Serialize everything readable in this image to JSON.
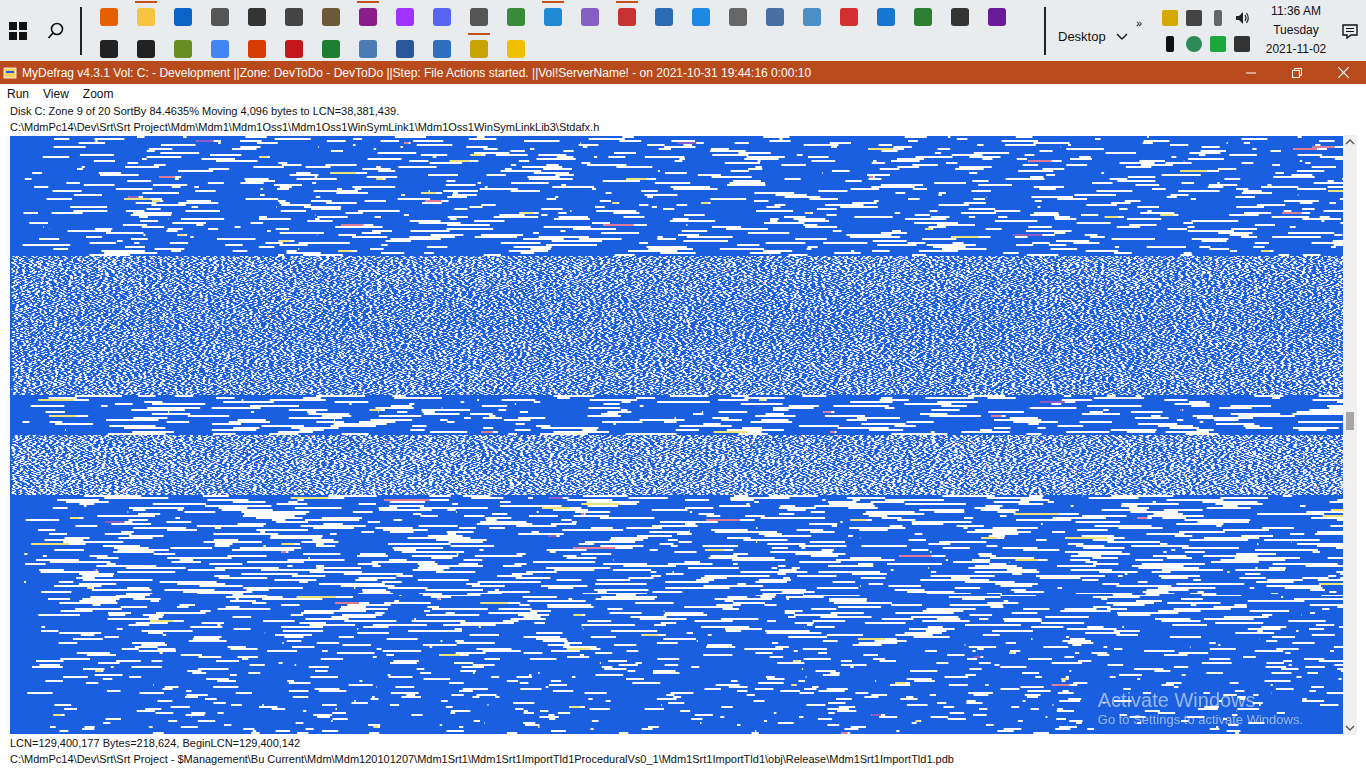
{
  "taskbar": {
    "top_row": [
      {
        "color": "#e66000",
        "running": false
      },
      {
        "color": "#f5c542",
        "running": true
      },
      {
        "color": "#0a64c8",
        "running": false
      },
      {
        "color": "#555555",
        "running": false
      },
      {
        "color": "#333333",
        "running": false
      },
      {
        "color": "#444444",
        "running": false
      },
      {
        "color": "#6b5a3a",
        "running": false
      },
      {
        "color": "#8b1c8b",
        "running": true
      },
      {
        "color": "#a033ff",
        "running": false
      },
      {
        "color": "#5865f2",
        "running": false
      },
      {
        "color": "#555555",
        "running": false
      },
      {
        "color": "#3a8a3a",
        "running": false
      },
      {
        "color": "#1f8ad2",
        "running": true
      },
      {
        "color": "#865fc5",
        "running": false
      },
      {
        "color": "#c83232",
        "running": true
      },
      {
        "color": "#2b6cb0",
        "running": false
      },
      {
        "color": "#1e88e5",
        "running": false
      },
      {
        "color": "#666666",
        "running": false
      },
      {
        "color": "#4a6fa5",
        "running": false
      },
      {
        "color": "#4a8fc5",
        "running": false
      },
      {
        "color": "#d32f2f",
        "running": false
      },
      {
        "color": "#1976d2",
        "running": false
      },
      {
        "color": "#2e7d32",
        "running": false
      },
      {
        "color": "#333333",
        "running": false
      },
      {
        "color": "#6a1b9a",
        "running": false
      }
    ],
    "bottom_row": [
      {
        "color": "#222222",
        "running": false
      },
      {
        "color": "#222222",
        "running": false
      },
      {
        "color": "#6b8e23",
        "running": false
      },
      {
        "color": "#4285f4",
        "running": false
      },
      {
        "color": "#d83b01",
        "running": false
      },
      {
        "color": "#c4161c",
        "running": false
      },
      {
        "color": "#1e7e34",
        "running": false
      },
      {
        "color": "#4a7bb5",
        "running": false
      },
      {
        "color": "#2b579a",
        "running": false
      },
      {
        "color": "#2f6fbf",
        "running": false
      },
      {
        "color": "#c8a400",
        "running": true
      },
      {
        "color": "#f0c000",
        "running": false
      }
    ],
    "toolbar": {
      "overflow": "»",
      "label": "Desktop"
    },
    "clock": {
      "time": "11:36 AM",
      "day": "Tuesday",
      "date": "2021-11-02"
    }
  },
  "window": {
    "title": "MyDefrag v4.3.1   Vol: C: - Development ||Zone: DevToDo - DevToDo ||Step: File Actions started. ||Vol!ServerName! -  on 2021-10-31 19:44:16 0:00:10",
    "menu": [
      "Run",
      "View",
      "Zoom"
    ],
    "status_line": "Disk C:   Zone 9 of 20   SortBy  84.4635%   Moving 4,096 bytes to LCN=38,381,439.",
    "current_file": "C:\\MdmPc14\\Dev\\Srt\\Srt Project\\Mdm\\Mdm1\\Mdm1Oss1\\Mdm1Oss1WinSymLink1\\Mdm1Oss1WinSymLinkLib3\\Stdafx.h",
    "disk_map": {
      "bands": [
        {
          "kind": "streak",
          "level": 0.72
        },
        {
          "kind": "streak",
          "level": 0.7
        },
        {
          "kind": "streak",
          "level": 0.68
        },
        {
          "kind": "streak",
          "level": 0.7
        },
        {
          "kind": "streak",
          "level": 0.66
        },
        {
          "kind": "streak",
          "level": 0.62
        },
        {
          "kind": "speckle",
          "level": 0.6
        },
        {
          "kind": "speckle",
          "level": 0.62
        },
        {
          "kind": "speckle",
          "level": 0.66
        },
        {
          "kind": "speckle",
          "level": 0.68
        },
        {
          "kind": "speckle",
          "level": 0.64
        },
        {
          "kind": "speckle",
          "level": 0.62
        },
        {
          "kind": "speckle",
          "level": 0.6
        },
        {
          "kind": "streak",
          "level": 0.6
        },
        {
          "kind": "streak",
          "level": 0.58
        },
        {
          "kind": "speckle",
          "level": 0.55
        },
        {
          "kind": "speckle",
          "level": 0.52
        },
        {
          "kind": "speckle",
          "level": 0.5
        },
        {
          "kind": "streak",
          "level": 0.5
        },
        {
          "kind": "streak",
          "level": 0.52
        },
        {
          "kind": "streak",
          "level": 0.55
        },
        {
          "kind": "streak",
          "level": 0.52
        },
        {
          "kind": "streak",
          "level": 0.5
        },
        {
          "kind": "streak",
          "level": 0.55
        },
        {
          "kind": "streak",
          "level": 0.6
        },
        {
          "kind": "streak",
          "level": 0.72
        },
        {
          "kind": "streak",
          "level": 0.78
        },
        {
          "kind": "streak",
          "level": 0.8
        },
        {
          "kind": "streak",
          "level": 0.84
        },
        {
          "kind": "streak",
          "level": 0.86
        }
      ]
    },
    "scrollbar": {
      "level": 0.46
    },
    "watermark": {
      "title": "Activate Windows",
      "subtitle": "Go to Settings to activate Windows."
    },
    "footer": {
      "cluster_info": "LCN=129,400,177     Bytes=218,624, BeginLCN=129,400,142",
      "file": "C:\\MdmPc14\\Dev\\Srt\\Srt Project - $Management\\Bu Current\\Mdm\\Mdm120101207\\Mdm1Srt1\\Mdm1Srt1ImportTld1ProceduralVs0_1\\Mdm1Srt1ImportTld1\\obj\\Release\\Mdm1Srt1ImportTld1.pdb"
    }
  }
}
